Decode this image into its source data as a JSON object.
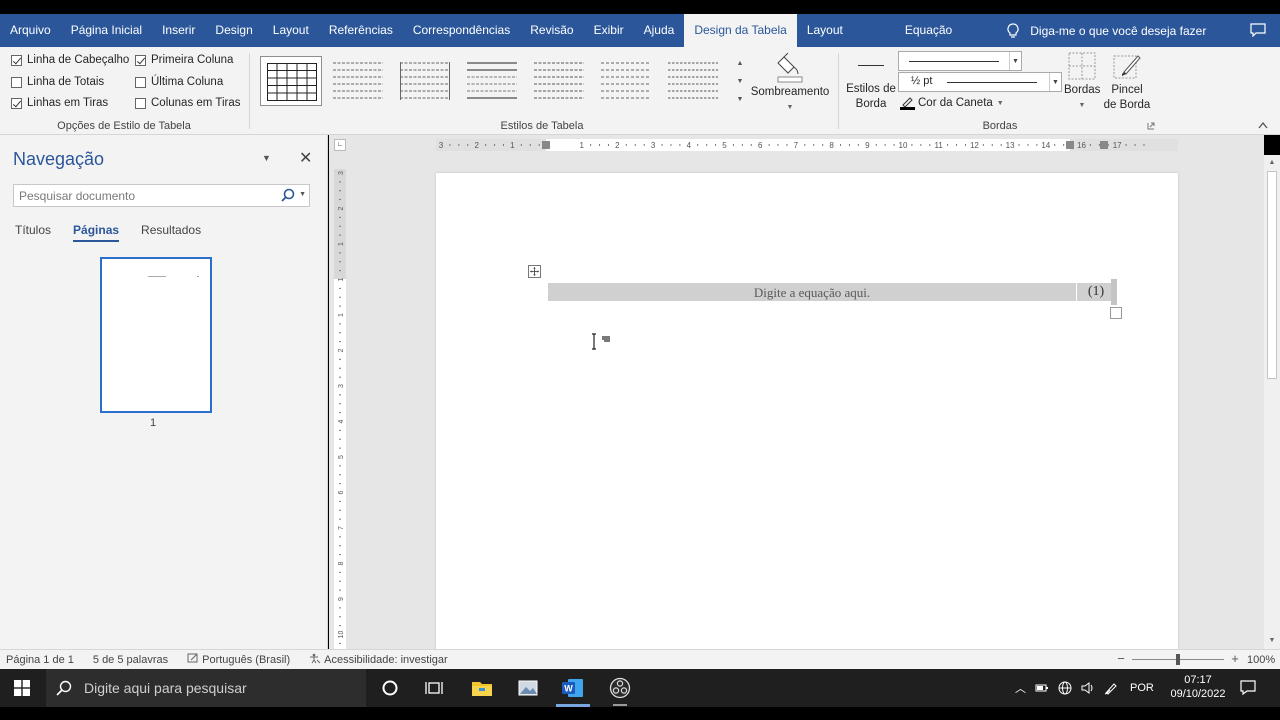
{
  "ribbon_tabs": [
    "Arquivo",
    "Página Inicial",
    "Inserir",
    "Design",
    "Layout",
    "Referências",
    "Correspondências",
    "Revisão",
    "Exibir",
    "Ajuda",
    "Design da Tabela",
    "Layout",
    "Equação"
  ],
  "active_tab_index": 10,
  "tell_me": "Diga-me o que você deseja fazer",
  "table_style_options": {
    "label": "Opções de Estilo de Tabela",
    "items": [
      {
        "label": "Linha de Cabeçalho",
        "checked": true
      },
      {
        "label": "Primeira Coluna",
        "checked": true
      },
      {
        "label": "Linha de Totais",
        "checked": false
      },
      {
        "label": "Última Coluna",
        "checked": false
      },
      {
        "label": "Linhas em Tiras",
        "checked": true
      },
      {
        "label": "Colunas em Tiras",
        "checked": false
      }
    ]
  },
  "table_styles": {
    "label": "Estilos de Tabela",
    "shading_label": "Sombreamento"
  },
  "borders": {
    "label": "Bordas",
    "border_styles_label_1": "Estilos de",
    "border_styles_label_2": "Borda",
    "weight": "½ pt",
    "pen_color_label": "Cor da Caneta",
    "borders_label": "Bordas",
    "painter_label_1": "Pincel",
    "painter_label_2": "de Borda"
  },
  "navigation": {
    "title": "Navegação",
    "search_placeholder": "Pesquisar documento",
    "tabs": [
      "Títulos",
      "Páginas",
      "Resultados"
    ],
    "active_tab_index": 1,
    "page_number": "1"
  },
  "document": {
    "equation_placeholder": "Digite a equação aqui.",
    "equation_number": "(1)"
  },
  "ruler_h": [
    "3",
    "2",
    "1",
    "1",
    "2",
    "3",
    "4",
    "5",
    "6",
    "7",
    "8",
    "9",
    "10",
    "11",
    "12",
    "13",
    "14",
    "16",
    "17"
  ],
  "ruler_v": [
    "3",
    "2",
    "1",
    "1",
    "1",
    "2",
    "3",
    "4",
    "5",
    "6",
    "7",
    "8",
    "9",
    "10"
  ],
  "status": {
    "page": "Página 1 de 1",
    "words": "5 de 5 palavras",
    "language": "Português (Brasil)",
    "accessibility": "Acessibilidade: investigar",
    "zoom": "100%"
  },
  "taskbar": {
    "search_placeholder": "Digite aqui para pesquisar",
    "language": "POR",
    "time": "07:17",
    "date": "09/10/2022"
  },
  "colors": {
    "ribbon_blue": "#2b579a",
    "ribbon_bg": "#f3f3f3",
    "equation_bg": "#d0d0d0",
    "taskbar_bg": "#1f1f1f"
  },
  "icons": [
    "lightbulb-icon",
    "comment-icon",
    "search-icon",
    "close-icon",
    "shading-icon",
    "pen-color-icon",
    "borders-icon",
    "border-painter-icon",
    "table-move-icon",
    "ibeam-cursor-icon",
    "windows-start-icon",
    "cortana-icon",
    "task-view-icon",
    "file-explorer-icon",
    "photos-icon",
    "word-icon",
    "obs-icon"
  ]
}
